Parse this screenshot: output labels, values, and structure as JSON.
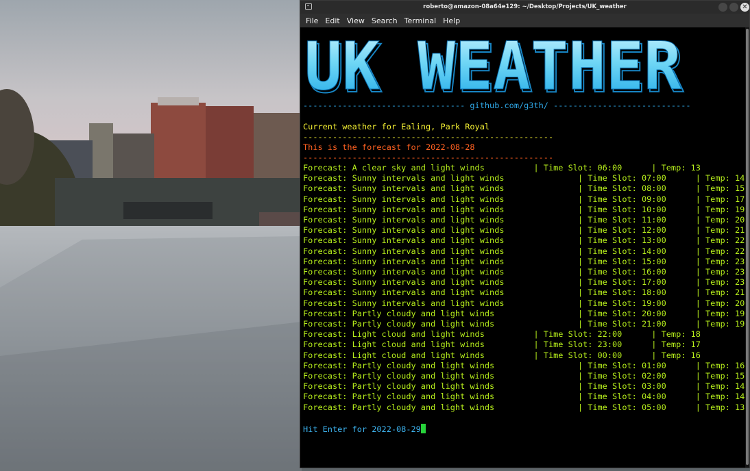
{
  "window": {
    "title": "roberto@amazon-08a64e129: ~/Desktop/Projects/UK_weather"
  },
  "menu": [
    "File",
    "Edit",
    "View",
    "Search",
    "Terminal",
    "Help"
  ],
  "banner": {
    "text": "UK WEATHER",
    "link_line": "--------------------------------- github.com/g3th/ ----------------------------"
  },
  "location_line": "Current weather for Ealing, Park Royal",
  "separator": "---------------------------------------------------",
  "forecast_line": "This is the forecast for 2022-08-28",
  "rows": [
    {
      "text": "Forecast: A clear sky and light winds          | Time Slot: 06:00      | Temp: 13"
    },
    {
      "text": "Forecast: Sunny intervals and light winds               | Time Slot: 07:00      | Temp: 14"
    },
    {
      "text": "Forecast: Sunny intervals and light winds               | Time Slot: 08:00      | Temp: 15"
    },
    {
      "text": "Forecast: Sunny intervals and light winds               | Time Slot: 09:00      | Temp: 17"
    },
    {
      "text": "Forecast: Sunny intervals and light winds               | Time Slot: 10:00      | Temp: 19"
    },
    {
      "text": "Forecast: Sunny intervals and light winds               | Time Slot: 11:00      | Temp: 20"
    },
    {
      "text": "Forecast: Sunny intervals and light winds               | Time Slot: 12:00      | Temp: 21"
    },
    {
      "text": "Forecast: Sunny intervals and light winds               | Time Slot: 13:00      | Temp: 22"
    },
    {
      "text": "Forecast: Sunny intervals and light winds               | Time Slot: 14:00      | Temp: 22"
    },
    {
      "text": "Forecast: Sunny intervals and light winds               | Time Slot: 15:00      | Temp: 23"
    },
    {
      "text": "Forecast: Sunny intervals and light winds               | Time Slot: 16:00      | Temp: 23"
    },
    {
      "text": "Forecast: Sunny intervals and light winds               | Time Slot: 17:00      | Temp: 23"
    },
    {
      "text": "Forecast: Sunny intervals and light winds               | Time Slot: 18:00      | Temp: 21"
    },
    {
      "text": "Forecast: Sunny intervals and light winds               | Time Slot: 19:00      | Temp: 20"
    },
    {
      "text": "Forecast: Partly cloudy and light winds                 | Time Slot: 20:00      | Temp: 19"
    },
    {
      "text": "Forecast: Partly cloudy and light winds                 | Time Slot: 21:00      | Temp: 19"
    },
    {
      "text": "Forecast: Light cloud and light winds          | Time Slot: 22:00      | Temp: 18"
    },
    {
      "text": "Forecast: Light cloud and light winds          | Time Slot: 23:00      | Temp: 17"
    },
    {
      "text": "Forecast: Light cloud and light winds          | Time Slot: 00:00      | Temp: 16"
    },
    {
      "text": "Forecast: Partly cloudy and light winds                 | Time Slot: 01:00      | Temp: 16"
    },
    {
      "text": "Forecast: Partly cloudy and light winds                 | Time Slot: 02:00      | Temp: 15"
    },
    {
      "text": "Forecast: Partly cloudy and light winds                 | Time Slot: 03:00      | Temp: 14"
    },
    {
      "text": "Forecast: Partly cloudy and light winds                 | Time Slot: 04:00      | Temp: 14"
    },
    {
      "text": "Forecast: Partly cloudy and light winds                 | Time Slot: 05:00      | Temp: 13"
    }
  ],
  "prompt": "Hit Enter for 2022-08-29",
  "colors": {
    "banner_top": "#c8f2ff",
    "banner_bottom": "#1da8e8",
    "location": "#f4f033",
    "forecast_header": "#ff6121",
    "rows": "#b8f01c",
    "prompt": "#3db4f0",
    "cursor": "#27d23a"
  },
  "icons": {
    "window_icon": "terminal-icon",
    "close": "close-icon"
  }
}
